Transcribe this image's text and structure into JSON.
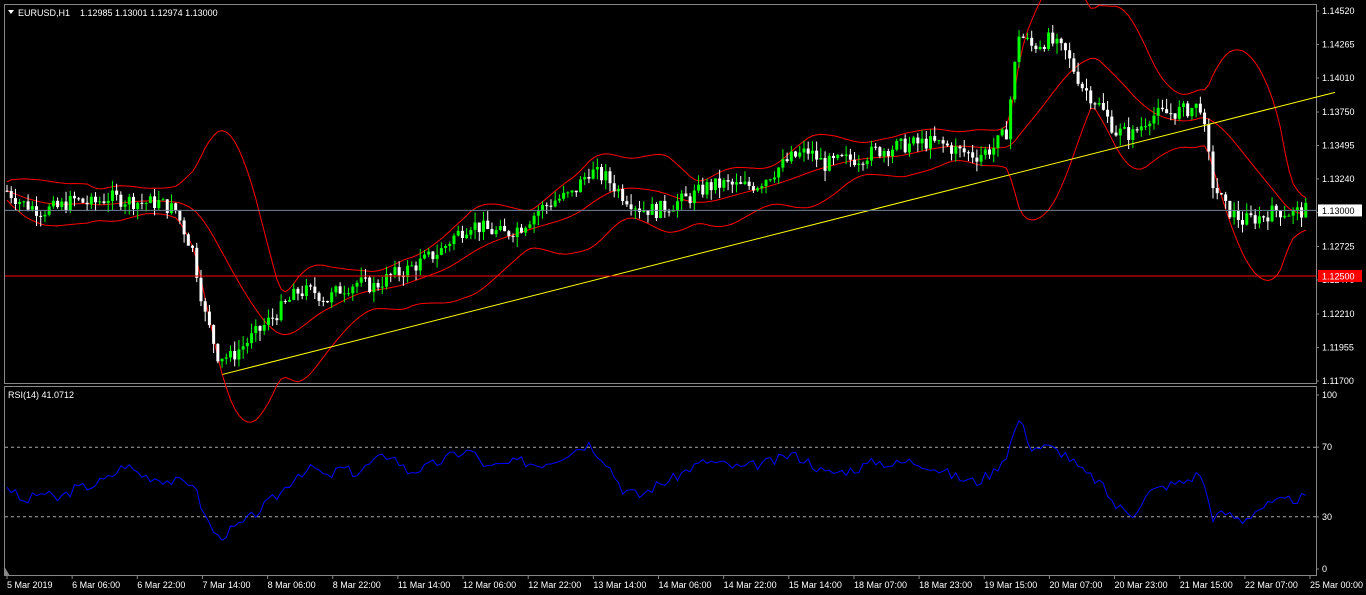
{
  "header": {
    "symbol": "EURUSD,H1",
    "ohlc": "1.12985 1.13001 1.12974 1.13000"
  },
  "rsi_header": {
    "label": "RSI(14) 41.0712"
  },
  "price_axis": {
    "ticks": [
      "1.14520",
      "1.14265",
      "1.14010",
      "1.13750",
      "1.13495",
      "1.13240",
      "1.12985",
      "1.12725",
      "1.12470",
      "1.12210",
      "1.11955",
      "1.11700"
    ],
    "current_price": "1.13000",
    "level_price": "1.12500",
    "current_price_color": "#ffffff",
    "level_color": "#ff0000"
  },
  "rsi_axis": {
    "ticks": [
      "100",
      "70",
      "30",
      "0"
    ]
  },
  "time_axis": {
    "labels": [
      "5 Mar 2019",
      "6 Mar 06:00",
      "6 Mar 22:00",
      "7 Mar 14:00",
      "8 Mar 06:00",
      "8 Mar 22:00",
      "11 Mar 14:00",
      "12 Mar 06:00",
      "12 Mar 22:00",
      "13 Mar 14:00",
      "14 Mar 06:00",
      "14 Mar 22:00",
      "15 Mar 14:00",
      "18 Mar 07:00",
      "18 Mar 23:00",
      "19 Mar 15:00",
      "20 Mar 07:00",
      "20 Mar 23:00",
      "21 Mar 15:00",
      "22 Mar 07:00",
      "25 Mar 00:00"
    ]
  },
  "colors": {
    "background": "#000000",
    "bull_candle": "#00ff00",
    "bear_candle": "#ffffff",
    "bollinger": "#ff0000",
    "trendline": "#ffff00",
    "rsi_line": "#0000ff",
    "grid": "#888888"
  },
  "chart_data": {
    "type": "candlestick",
    "symbol": "EURUSD",
    "timeframe": "H1",
    "price_range": [
      1.117,
      1.1452
    ],
    "series_points": [
      [
        0,
        1.1315
      ],
      [
        4,
        1.1305
      ],
      [
        8,
        1.13
      ],
      [
        12,
        1.1302
      ],
      [
        16,
        1.1308
      ],
      [
        20,
        1.1305
      ],
      [
        24,
        1.131
      ],
      [
        28,
        1.1308
      ],
      [
        32,
        1.1306
      ],
      [
        36,
        1.1306
      ],
      [
        40,
        1.13
      ],
      [
        44,
        1.127
      ],
      [
        47,
        1.122
      ],
      [
        50,
        1.119
      ],
      [
        53,
        1.1188
      ],
      [
        57,
        1.12
      ],
      [
        61,
        1.1212
      ],
      [
        65,
        1.1225
      ],
      [
        69,
        1.1238
      ],
      [
        73,
        1.1238
      ],
      [
        76,
        1.1232
      ],
      [
        79,
        1.124
      ],
      [
        83,
        1.1245
      ],
      [
        87,
        1.1242
      ],
      [
        91,
        1.125
      ],
      [
        95,
        1.1255
      ],
      [
        99,
        1.1262
      ],
      [
        103,
        1.127
      ],
      [
        106,
        1.128
      ],
      [
        110,
        1.129
      ],
      [
        114,
        1.1285
      ],
      [
        118,
        1.1282
      ],
      [
        122,
        1.1288
      ],
      [
        126,
        1.13
      ],
      [
        130,
        1.1308
      ],
      [
        134,
        1.1312
      ],
      [
        138,
        1.133
      ],
      [
        142,
        1.1325
      ],
      [
        146,
        1.1312
      ],
      [
        150,
        1.1302
      ],
      [
        154,
        1.13
      ],
      [
        158,
        1.1305
      ],
      [
        162,
        1.131
      ],
      [
        166,
        1.1318
      ],
      [
        170,
        1.132
      ],
      [
        174,
        1.1318
      ],
      [
        178,
        1.132
      ],
      [
        182,
        1.133
      ],
      [
        186,
        1.134
      ],
      [
        190,
        1.1345
      ],
      [
        194,
        1.1335
      ],
      [
        198,
        1.1338
      ],
      [
        202,
        1.134
      ],
      [
        206,
        1.1345
      ],
      [
        210,
        1.1348
      ],
      [
        214,
        1.135
      ],
      [
        218,
        1.1352
      ],
      [
        222,
        1.135
      ],
      [
        226,
        1.1345
      ],
      [
        230,
        1.1342
      ],
      [
        234,
        1.1348
      ],
      [
        237,
        1.136
      ],
      [
        240,
        1.1435
      ],
      [
        243,
        1.1425
      ],
      [
        247,
        1.143
      ],
      [
        251,
        1.142
      ],
      [
        255,
        1.1395
      ],
      [
        259,
        1.138
      ],
      [
        263,
        1.136
      ],
      [
        267,
        1.1358
      ],
      [
        271,
        1.1372
      ],
      [
        275,
        1.1374
      ],
      [
        279,
        1.1376
      ],
      [
        283,
        1.138
      ],
      [
        286,
        1.132
      ],
      [
        289,
        1.1302
      ],
      [
        293,
        1.1292
      ],
      [
        297,
        1.1295
      ],
      [
        301,
        1.13
      ],
      [
        305,
        1.1298
      ],
      [
        308,
        1.13
      ]
    ],
    "last_close": 1.13,
    "horizontal_level": 1.125,
    "trendline": {
      "start": [
        "7 Mar 14:00",
        1.1175
      ],
      "end": [
        "25 Mar 00:00",
        1.139
      ]
    },
    "rsi": {
      "period": 14,
      "last": 41.0712,
      "levels": [
        70,
        30
      ],
      "range": [
        0,
        100
      ],
      "points": [
        [
          0,
          48
        ],
        [
          4,
          38
        ],
        [
          8,
          44
        ],
        [
          12,
          40
        ],
        [
          16,
          46
        ],
        [
          20,
          48
        ],
        [
          24,
          52
        ],
        [
          28,
          60
        ],
        [
          32,
          54
        ],
        [
          36,
          52
        ],
        [
          40,
          50
        ],
        [
          44,
          50
        ],
        [
          47,
          30
        ],
        [
          50,
          18
        ],
        [
          53,
          22
        ],
        [
          57,
          28
        ],
        [
          61,
          36
        ],
        [
          65,
          44
        ],
        [
          69,
          55
        ],
        [
          73,
          58
        ],
        [
          76,
          52
        ],
        [
          79,
          58
        ],
        [
          83,
          55
        ],
        [
          87,
          62
        ],
        [
          91,
          66
        ],
        [
          95,
          56
        ],
        [
          99,
          58
        ],
        [
          103,
          62
        ],
        [
          106,
          66
        ],
        [
          110,
          68
        ],
        [
          114,
          58
        ],
        [
          118,
          60
        ],
        [
          122,
          62
        ],
        [
          126,
          60
        ],
        [
          130,
          63
        ],
        [
          134,
          68
        ],
        [
          138,
          72
        ],
        [
          142,
          62
        ],
        [
          146,
          46
        ],
        [
          150,
          42
        ],
        [
          154,
          48
        ],
        [
          158,
          52
        ],
        [
          162,
          58
        ],
        [
          166,
          62
        ],
        [
          170,
          60
        ],
        [
          174,
          58
        ],
        [
          178,
          60
        ],
        [
          182,
          62
        ],
        [
          186,
          66
        ],
        [
          190,
          62
        ],
        [
          194,
          55
        ],
        [
          198,
          56
        ],
        [
          202,
          58
        ],
        [
          206,
          62
        ],
        [
          210,
          60
        ],
        [
          214,
          62
        ],
        [
          218,
          60
        ],
        [
          222,
          56
        ],
        [
          226,
          52
        ],
        [
          230,
          50
        ],
        [
          234,
          56
        ],
        [
          237,
          66
        ],
        [
          240,
          86
        ],
        [
          243,
          70
        ],
        [
          247,
          70
        ],
        [
          251,
          66
        ],
        [
          255,
          56
        ],
        [
          259,
          50
        ],
        [
          263,
          36
        ],
        [
          267,
          32
        ],
        [
          271,
          44
        ],
        [
          275,
          48
        ],
        [
          279,
          50
        ],
        [
          283,
          55
        ],
        [
          286,
          30
        ],
        [
          289,
          32
        ],
        [
          293,
          28
        ],
        [
          297,
          35
        ],
        [
          301,
          38
        ],
        [
          305,
          40
        ],
        [
          308,
          41
        ]
      ]
    }
  }
}
